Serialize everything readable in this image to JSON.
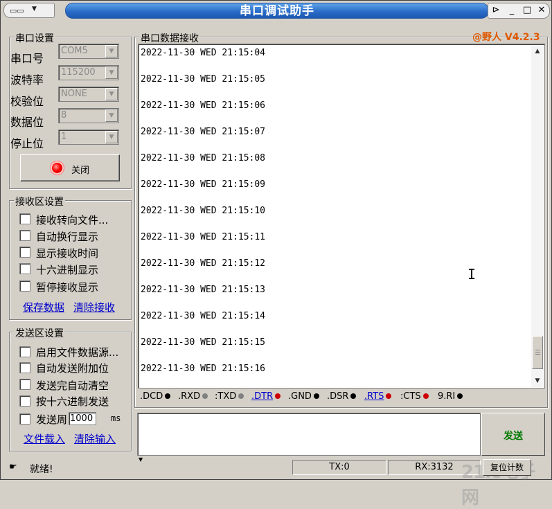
{
  "app": {
    "title": "串口调试助手",
    "version_badge": "@野人 V4.2.3",
    "accent_color": "#e05a00",
    "pin_icon": "pin-icon",
    "min_icon": "minimize-icon",
    "max_icon": "maximize-icon",
    "close_icon": "close-icon"
  },
  "port_settings": {
    "group_title": "串口设置",
    "port_label": "串口号",
    "port_value": "COM5",
    "baud_label": "波特率",
    "baud_value": "115200",
    "parity_label": "校验位",
    "parity_value": "NONE",
    "databits_label": "数据位",
    "databits_value": "8",
    "stopbits_label": "停止位",
    "stopbits_value": "1",
    "toggle_button": "关闭",
    "status_color": "#ff0000"
  },
  "receive_settings": {
    "group_title": "接收区设置",
    "options": [
      {
        "label": "接收转向文件...",
        "checked": false
      },
      {
        "label": "自动换行显示",
        "checked": false
      },
      {
        "label": "显示接收时间",
        "checked": false
      },
      {
        "label": "十六进制显示",
        "checked": false
      },
      {
        "label": "暂停接收显示",
        "checked": false
      }
    ],
    "save_link": "保存数据",
    "clear_link": "清除接收"
  },
  "send_settings": {
    "group_title": "发送区设置",
    "options": [
      {
        "label": "启用文件数据源...",
        "checked": false
      },
      {
        "label": "自动发送附加位",
        "checked": false
      },
      {
        "label": "发送完自动清空",
        "checked": false
      },
      {
        "label": "按十六进制发送",
        "checked": false
      }
    ],
    "period_label": "发送周",
    "period_value": "1000",
    "period_unit": "ms",
    "load_link": "文件载入",
    "clear_link": "清除输入"
  },
  "receive_area": {
    "title": "串口数据接收",
    "lines": [
      "2022-11-30 WED 21:15:04",
      "2022-11-30 WED 21:15:05",
      "2022-11-30 WED 21:15:06",
      "2022-11-30 WED 21:15:07",
      "2022-11-30 WED 21:15:08",
      "2022-11-30 WED 21:15:09",
      "2022-11-30 WED 21:15:10",
      "2022-11-30 WED 21:15:11",
      "2022-11-30 WED 21:15:12",
      "2022-11-30 WED 21:15:13",
      "2022-11-30 WED 21:15:14",
      "2022-11-30 WED 21:15:15",
      "2022-11-30 WED 21:15:16"
    ]
  },
  "signals": [
    {
      "label": ".DCD",
      "color": "#000000",
      "link": false
    },
    {
      "label": ".RXD",
      "color": "#808080",
      "link": false
    },
    {
      "label": ":TXD",
      "color": "#808080",
      "link": false
    },
    {
      "label": ".DTR",
      "color": "#cc0000",
      "link": true
    },
    {
      "label": ".GND",
      "color": "#000000",
      "link": false
    },
    {
      "label": ".DSR",
      "color": "#000000",
      "link": false
    },
    {
      "label": ".RTS",
      "color": "#cc0000",
      "link": true
    },
    {
      "label": ":CTS",
      "color": "#cc0000",
      "link": false
    },
    {
      "label": "9.RI",
      "color": "#000000",
      "link": false
    }
  ],
  "send_area": {
    "send_button": "发送",
    "send_color": "#007a00"
  },
  "status_bar": {
    "ready_text": "就绪!",
    "tx": "TX:0",
    "rx": "RX:3132",
    "reset_button": "复位计数",
    "watermark": "21ic电子网"
  }
}
